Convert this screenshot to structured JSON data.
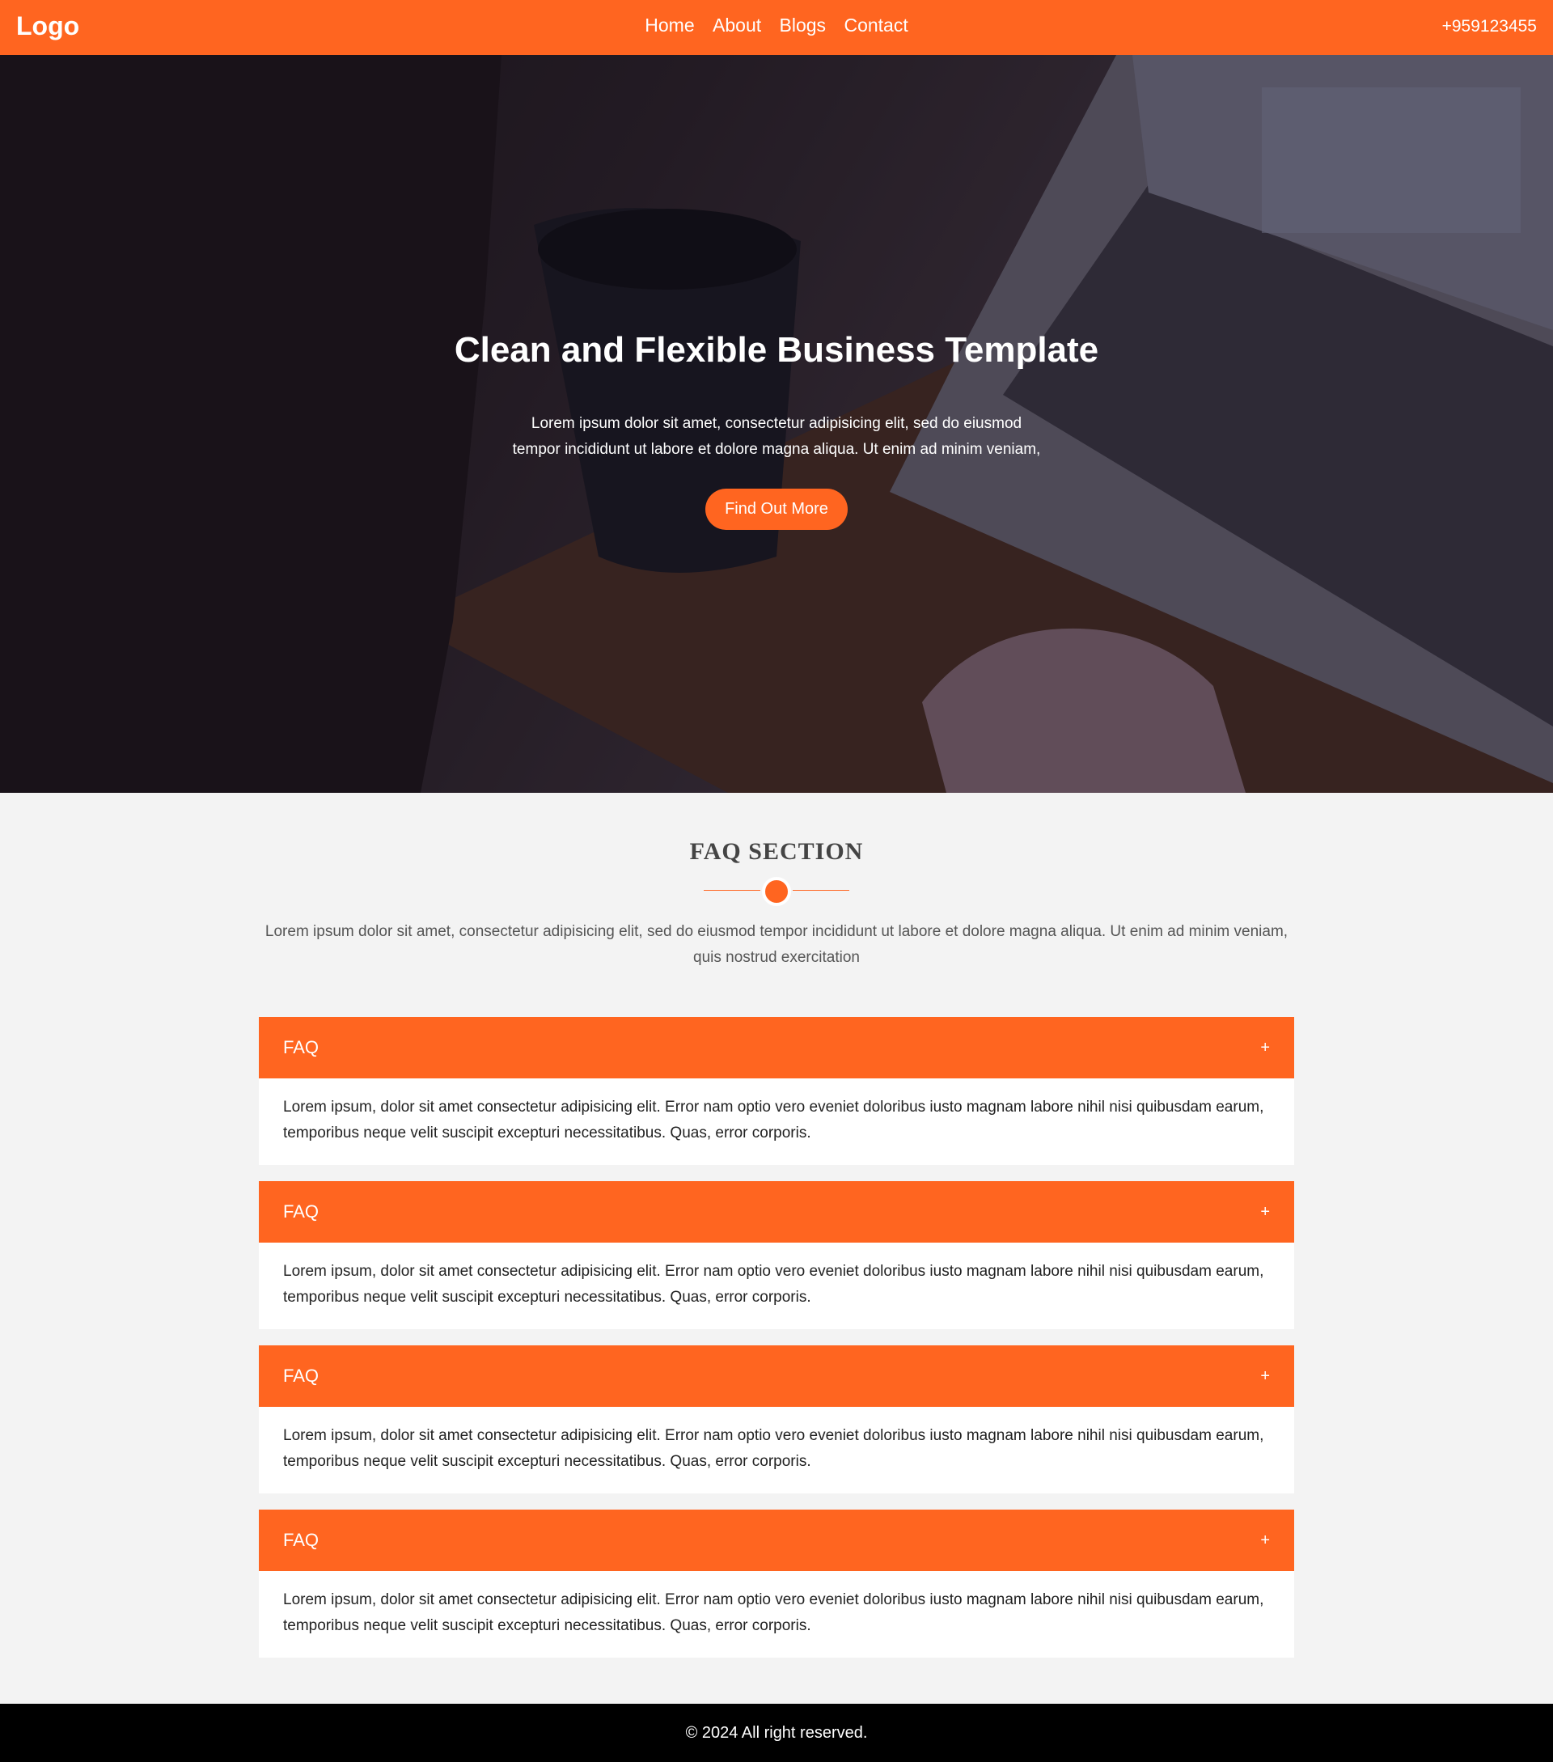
{
  "navbar": {
    "logo": "Logo",
    "links": [
      "Home",
      "About",
      "Blogs",
      "Contact"
    ],
    "phone": "+959123455"
  },
  "hero": {
    "title": "Clean and Flexible Business Template",
    "desc_line1": "Lorem ipsum dolor sit amet, consectetur adipisicing elit, sed do eiusmod",
    "desc_line2": "tempor incididunt ut labore et dolore magna aliqua. Ut enim ad minim veniam,",
    "button": "Find Out More"
  },
  "faq": {
    "heading": "FAQ SECTION",
    "intro": "Lorem ipsum dolor sit amet, consectetur adipisicing elit, sed do eiusmod tempor incididunt ut labore et dolore magna aliqua. Ut enim ad minim veniam, quis nostrud exercitation",
    "items": [
      {
        "question": "FAQ",
        "toggle": "+",
        "answer": "Lorem ipsum, dolor sit amet consectetur adipisicing elit. Error nam optio vero eveniet doloribus iusto magnam labore nihil nisi quibusdam earum, temporibus neque velit suscipit excepturi necessitatibus. Quas, error corporis."
      },
      {
        "question": "FAQ",
        "toggle": "+",
        "answer": "Lorem ipsum, dolor sit amet consectetur adipisicing elit. Error nam optio vero eveniet doloribus iusto magnam labore nihil nisi quibusdam earum, temporibus neque velit suscipit excepturi necessitatibus. Quas, error corporis."
      },
      {
        "question": "FAQ",
        "toggle": "+",
        "answer": "Lorem ipsum, dolor sit amet consectetur adipisicing elit. Error nam optio vero eveniet doloribus iusto magnam labore nihil nisi quibusdam earum, temporibus neque velit suscipit excepturi necessitatibus. Quas, error corporis."
      },
      {
        "question": "FAQ",
        "toggle": "+",
        "answer": "Lorem ipsum, dolor sit amet consectetur adipisicing elit. Error nam optio vero eveniet doloribus iusto magnam labore nihil nisi quibusdam earum, temporibus neque velit suscipit excepturi necessitatibus. Quas, error corporis."
      }
    ]
  },
  "footer": {
    "copyright": "© 2024 All right reserved."
  },
  "colors": {
    "accent": "#ff6520",
    "page_bg": "#f3f3f3",
    "footer_bg": "#000000"
  }
}
